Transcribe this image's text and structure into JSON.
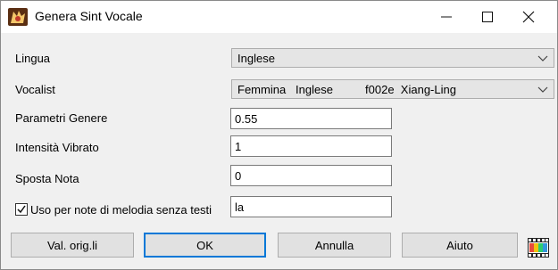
{
  "window": {
    "title": "Genera Sint Vocale"
  },
  "form": {
    "lingua": {
      "label": "Lingua",
      "value": "Inglese"
    },
    "vocalist": {
      "label": "Vocalist",
      "value": "Femmina   Inglese          f002e  Xiang-Ling"
    },
    "parametri": {
      "label": "Parametri Genere",
      "value": "0.55"
    },
    "vibrato": {
      "label": "Intensità Vibrato",
      "value": "1"
    },
    "sposta": {
      "label": "Sposta Nota",
      "value": "0"
    },
    "uso": {
      "label": "Uso per note di melodia senza testi",
      "checked": true,
      "value": "la"
    }
  },
  "buttons": {
    "defaults": "Val. orig.li",
    "ok": "OK",
    "cancel": "Annulla",
    "help": "Aiuto"
  },
  "colors": {
    "accent": "#0078d7",
    "face": "#f0f0f0",
    "button": "#e1e1e1"
  }
}
